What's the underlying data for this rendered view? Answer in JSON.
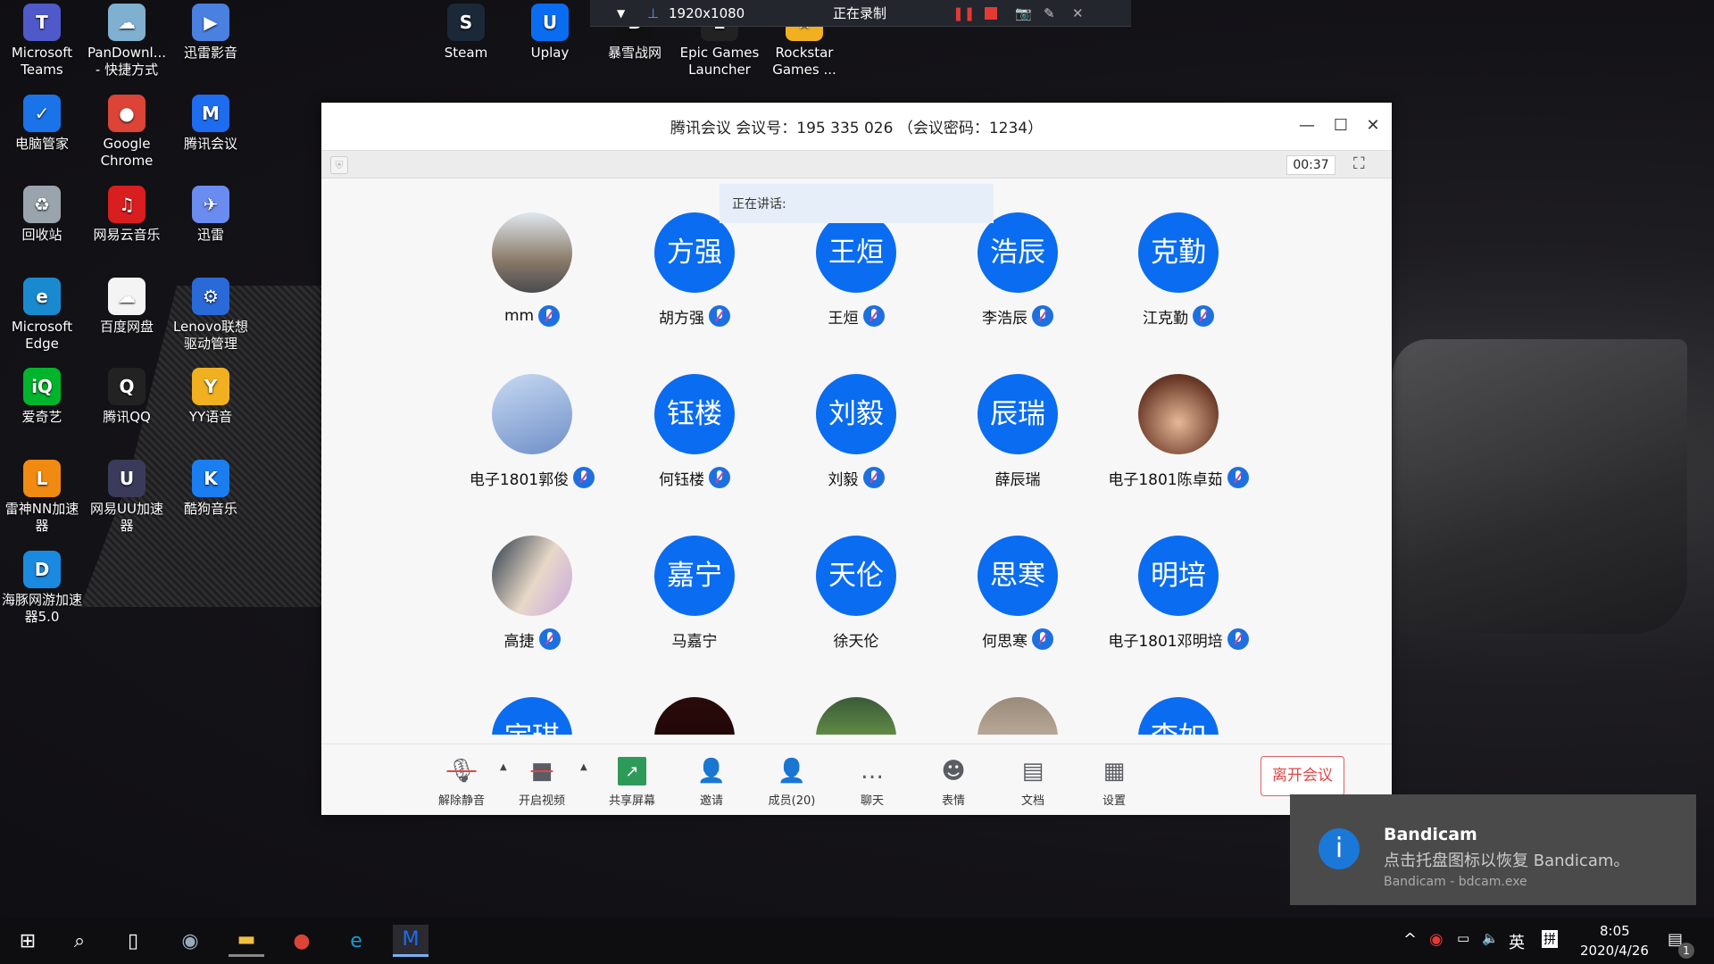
{
  "desktop_icons": [
    {
      "label": "Microsoft Teams",
      "glyph": "T",
      "color": "#5059c9"
    },
    {
      "label": "PanDownl... - 快捷方式",
      "glyph": "☁",
      "color": "#7fb0d0"
    },
    {
      "label": "迅雷影音",
      "glyph": "▶",
      "color": "#4a80e0"
    },
    {
      "label": "电脑管家",
      "glyph": "✓",
      "color": "#1a73e8"
    },
    {
      "label": "Google Chrome",
      "glyph": "●",
      "color": "#db4437"
    },
    {
      "label": "腾讯会议",
      "glyph": "M",
      "color": "#1e6cf0"
    },
    {
      "label": "回收站",
      "glyph": "♻",
      "color": "#9aa4ad"
    },
    {
      "label": "网易云音乐",
      "glyph": "♫",
      "color": "#d81e1e"
    },
    {
      "label": "迅雷",
      "glyph": "✈",
      "color": "#6a8cf0"
    },
    {
      "label": "Microsoft Edge",
      "glyph": "e",
      "color": "#1a8ad0"
    },
    {
      "label": "百度网盘",
      "glyph": "☁",
      "color": "#f4f4f4"
    },
    {
      "label": "Lenovo联想驱动管理",
      "glyph": "⚙",
      "color": "#2a6ad8"
    },
    {
      "label": "爱奇艺",
      "glyph": "iQ",
      "color": "#00b52b"
    },
    {
      "label": "腾讯QQ",
      "glyph": "Q",
      "color": "#222"
    },
    {
      "label": "YY语音",
      "glyph": "Y",
      "color": "#f0b020"
    },
    {
      "label": "雷神NN加速器",
      "glyph": "L",
      "color": "#f08a10"
    },
    {
      "label": "网易UU加速器",
      "glyph": "U",
      "color": "#3a3a5a"
    },
    {
      "label": "酷狗音乐",
      "glyph": "K",
      "color": "#1a7ef0"
    },
    {
      "label": "海豚网游加速器5.0",
      "glyph": "D",
      "color": "#1a8ae0"
    }
  ],
  "top_icons": [
    {
      "label": "Steam",
      "glyph": "S",
      "color": "#1b2838"
    },
    {
      "label": "Uplay",
      "glyph": "U",
      "color": "#0a6cf0"
    },
    {
      "label": "暴雪战网",
      "glyph": "B",
      "color": "#111"
    },
    {
      "label": "Epic Games Launcher",
      "glyph": "E",
      "color": "#222"
    },
    {
      "label": "Rockstar Games ...",
      "glyph": "★",
      "color": "#f0b020"
    }
  ],
  "recorder": {
    "resolution": "1920x1080",
    "status": "正在录制",
    "accent": "#e53935"
  },
  "meeting": {
    "title": "腾讯会议 会议号：195 335 026 （会议密码：1234）",
    "timer": "00:37",
    "speaking_label": "正在讲话:",
    "accent": "#0a6cf0",
    "participants": [
      {
        "name": "mm",
        "avatar": "",
        "photo": "linear-gradient(#dfe8ef,#8a7a68 60%,#4a4a50)",
        "mic": true
      },
      {
        "name": "胡方强",
        "avatar": "方强",
        "mic": true,
        "host": true
      },
      {
        "name": "王烜",
        "avatar": "王烜",
        "mic": true
      },
      {
        "name": "李浩辰",
        "avatar": "浩辰",
        "mic": true
      },
      {
        "name": "江克勤",
        "avatar": "克勤",
        "mic": true
      },
      {
        "name": "电子1801郭俊",
        "avatar": "",
        "photo": "linear-gradient(160deg,#c8daf2,#6f8fc8)",
        "mic": true
      },
      {
        "name": "何钰楼",
        "avatar": "钰楼",
        "mic": true
      },
      {
        "name": "刘毅",
        "avatar": "刘毅",
        "mic": true
      },
      {
        "name": "薛辰瑞",
        "avatar": "辰瑞",
        "mic": false
      },
      {
        "name": "电子1801陈卓茹",
        "avatar": "",
        "photo": "radial-gradient(circle at 50% 60%,#e8b898,#6a3a28 70%,#2a1a18)",
        "mic": true
      },
      {
        "name": "高捷",
        "avatar": "",
        "photo": "linear-gradient(120deg,#2a3a48,#e8d8c8 55%,#c8a8e0)",
        "mic": true
      },
      {
        "name": "马嘉宁",
        "avatar": "嘉宁",
        "mic": false
      },
      {
        "name": "徐天伦",
        "avatar": "天伦",
        "mic": false
      },
      {
        "name": "何思寒",
        "avatar": "思寒",
        "mic": true
      },
      {
        "name": "电子1801邓明培",
        "avatar": "明培",
        "mic": true
      },
      {
        "name": "",
        "avatar": "宇琪",
        "mic": false
      },
      {
        "name": "",
        "avatar": "",
        "photo": "linear-gradient(#2a0a0a,#1a0505)",
        "mic": false
      },
      {
        "name": "",
        "avatar": "",
        "photo": "linear-gradient(#3a5a3a,#8ac050)",
        "mic": false
      },
      {
        "name": "",
        "avatar": "",
        "photo": "linear-gradient(#9a8a7a,#d8c8b8)",
        "mic": false
      },
      {
        "name": "",
        "avatar": "李如",
        "mic": false
      }
    ],
    "toolbar": [
      {
        "label": "解除静音",
        "icon": "mic-muted-icon",
        "glyph": "🎙"
      },
      {
        "label": "开启视频",
        "icon": "camera-off-icon",
        "glyph": "■"
      },
      {
        "label": "共享屏幕",
        "icon": "share-screen-icon",
        "glyph": "↗"
      },
      {
        "label": "邀请",
        "icon": "invite-icon",
        "glyph": "👤"
      },
      {
        "label": "成员(20)",
        "icon": "members-icon",
        "glyph": "👤"
      },
      {
        "label": "聊天",
        "icon": "chat-icon",
        "glyph": "…"
      },
      {
        "label": "表情",
        "icon": "emoji-icon",
        "glyph": "☻"
      },
      {
        "label": "文档",
        "icon": "document-icon",
        "glyph": "▤"
      },
      {
        "label": "设置",
        "icon": "settings-icon",
        "glyph": "▦"
      }
    ],
    "leave_label": "离开会议",
    "leave_color": "#e04848"
  },
  "toast": {
    "title": "Bandicam",
    "message": "点击托盘图标以恢复 Bandicam。",
    "source": "Bandicam - bdcam.exe"
  },
  "taskbar": {
    "ime_lang": "英",
    "ime_mode": "拼",
    "time": "8:05",
    "date": "2020/4/26",
    "notification_count": "1"
  }
}
